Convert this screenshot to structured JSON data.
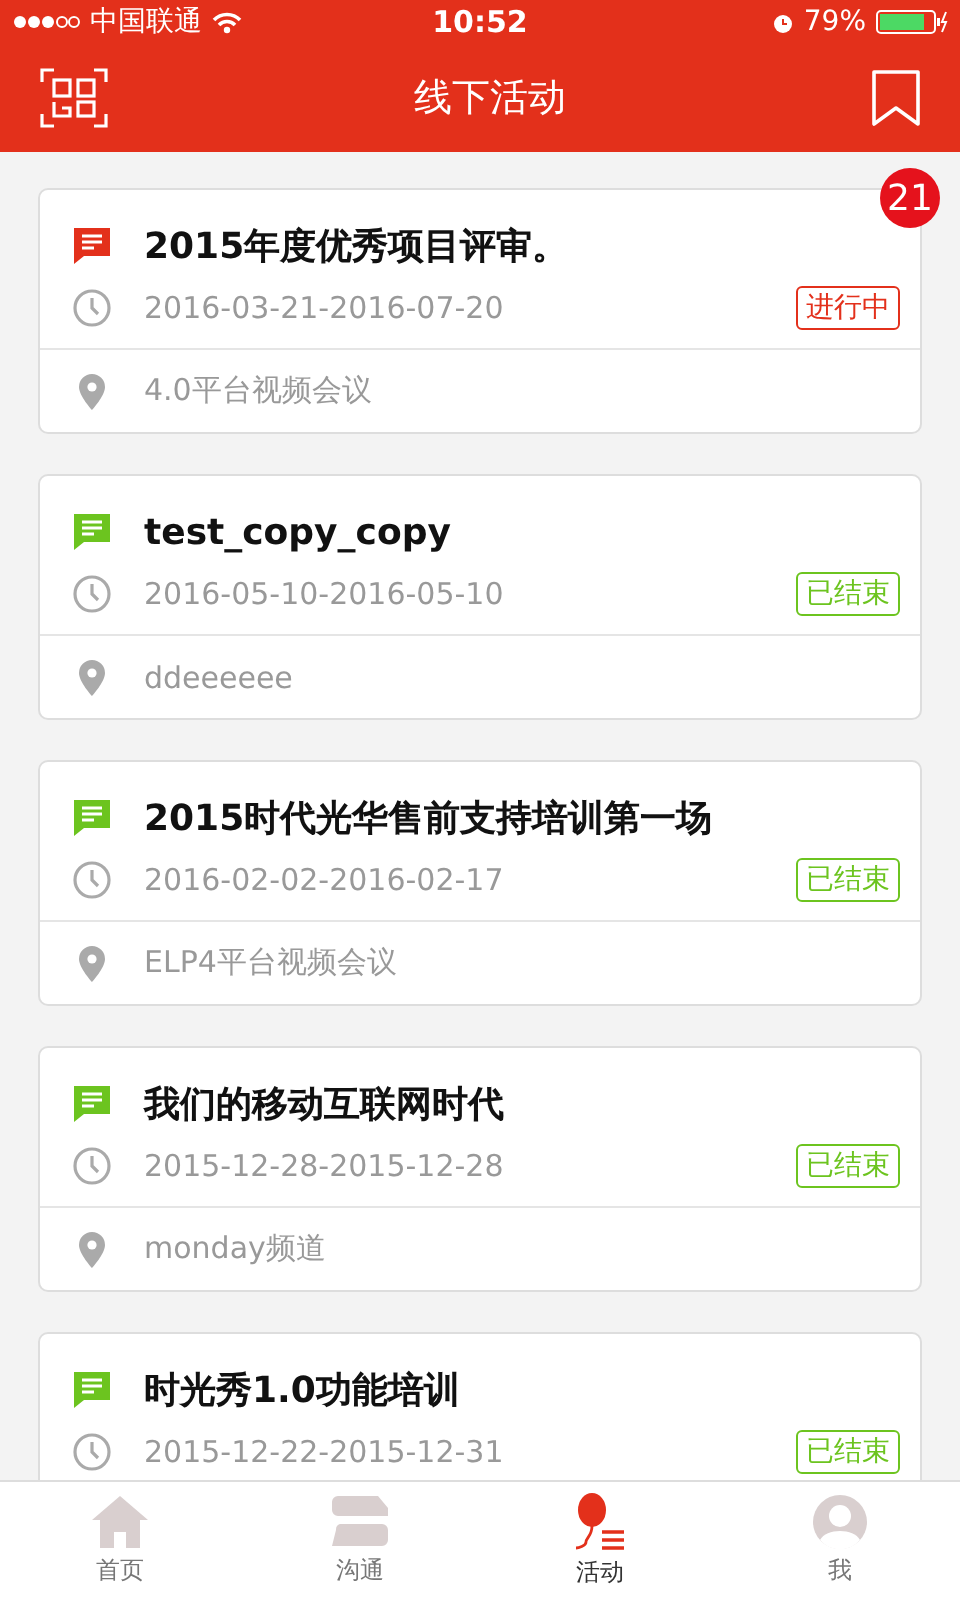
{
  "status_bar": {
    "carrier": "中国联通",
    "time": "10:52",
    "battery": "79%"
  },
  "header": {
    "title": "线下活动"
  },
  "badge": "21",
  "activities": [
    {
      "title": "2015年度优秀项目评审。",
      "dates": "2016-03-21-2016-07-20",
      "status": "进行中",
      "kind": "ongoing",
      "location": "4.0平台视频会议"
    },
    {
      "title": "test_copy_copy",
      "dates": "2016-05-10-2016-05-10",
      "status": "已结束",
      "kind": "ended",
      "location": "ddeeeeee"
    },
    {
      "title": "2015时代光华售前支持培训第一场",
      "dates": "2016-02-02-2016-02-17",
      "status": "已结束",
      "kind": "ended",
      "location": "ELP4平台视频会议"
    },
    {
      "title": "我们的移动互联网时代",
      "dates": "2015-12-28-2015-12-28",
      "status": "已结束",
      "kind": "ended",
      "location": "monday频道"
    },
    {
      "title": "时光秀1.0功能培训",
      "dates": "2015-12-22-2015-12-31",
      "status": "已结束",
      "kind": "ended"
    }
  ],
  "tabs": [
    {
      "label": "首页",
      "kind": "home",
      "selected": false
    },
    {
      "label": "沟通",
      "kind": "chat",
      "selected": false
    },
    {
      "label": "活动",
      "kind": "balloon",
      "selected": true
    },
    {
      "label": "我",
      "kind": "user",
      "selected": false
    }
  ]
}
